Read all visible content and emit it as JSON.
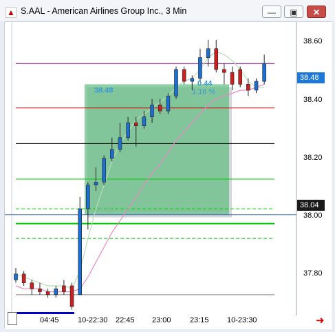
{
  "window": {
    "title": "S.AAL - American Airlines Group Inc., 3 Min"
  },
  "window_buttons": {
    "minimize": "—",
    "restore": "▣",
    "close": "✕"
  },
  "icons": {
    "app_icon": "chart-app-icon",
    "scroll_right": "red-arrow-icon"
  },
  "price_axis": {
    "ticks": [
      "38.60",
      "38.40",
      "38.20",
      "38.00",
      "37.80"
    ]
  },
  "time_axis": {
    "ticks": [
      "04:45",
      "10-22:30",
      "22:45",
      "23:00",
      "23:15",
      "10-23:30"
    ]
  },
  "price_tags": {
    "last": "38.48",
    "reference": "38.04"
  },
  "overlay": {
    "box_price": "38.48",
    "box_low": "38.04",
    "change": "0.44",
    "pct": "1.16 %"
  },
  "chart_data": {
    "type": "candlestick",
    "symbol": "S.AAL",
    "interval": "3 Min",
    "ylim": [
      37.7,
      38.69
    ],
    "bar_count": 32,
    "candles": [
      {
        "o": 37.82,
        "h": 37.86,
        "l": 37.81,
        "c": 37.84
      },
      {
        "o": 37.84,
        "h": 37.85,
        "l": 37.8,
        "c": 37.81
      },
      {
        "o": 37.81,
        "h": 37.82,
        "l": 37.77,
        "c": 37.79
      },
      {
        "o": 37.79,
        "h": 37.81,
        "l": 37.77,
        "c": 37.78
      },
      {
        "o": 37.78,
        "h": 37.79,
        "l": 37.76,
        "c": 37.77
      },
      {
        "o": 37.77,
        "h": 37.8,
        "l": 37.76,
        "c": 37.79
      },
      {
        "o": 37.8,
        "h": 37.82,
        "l": 37.77,
        "c": 37.78
      },
      {
        "o": 37.8,
        "h": 37.81,
        "l": 37.72,
        "c": 37.73
      },
      {
        "o": 37.77,
        "h": 38.1,
        "l": 37.77,
        "c": 38.06
      },
      {
        "o": 38.06,
        "h": 38.15,
        "l": 37.99,
        "c": 38.14
      },
      {
        "o": 38.14,
        "h": 38.2,
        "l": 38.12,
        "c": 38.15
      },
      {
        "o": 38.15,
        "h": 38.24,
        "l": 38.14,
        "c": 38.23
      },
      {
        "o": 38.23,
        "h": 38.3,
        "l": 38.22,
        "c": 38.26
      },
      {
        "o": 38.26,
        "h": 38.35,
        "l": 38.25,
        "c": 38.3
      },
      {
        "o": 38.3,
        "h": 38.37,
        "l": 38.29,
        "c": 38.35
      },
      {
        "o": 38.35,
        "h": 38.37,
        "l": 38.27,
        "c": 38.34
      },
      {
        "o": 38.34,
        "h": 38.39,
        "l": 38.33,
        "c": 38.37
      },
      {
        "o": 38.37,
        "h": 38.43,
        "l": 38.35,
        "c": 38.41
      },
      {
        "o": 38.41,
        "h": 38.43,
        "l": 38.38,
        "c": 38.39
      },
      {
        "o": 38.39,
        "h": 38.45,
        "l": 38.38,
        "c": 38.44
      },
      {
        "o": 38.44,
        "h": 38.54,
        "l": 38.43,
        "c": 38.53
      },
      {
        "o": 38.53,
        "h": 38.54,
        "l": 38.48,
        "c": 38.49
      },
      {
        "o": 38.49,
        "h": 38.51,
        "l": 38.46,
        "c": 38.5
      },
      {
        "o": 38.5,
        "h": 38.6,
        "l": 38.49,
        "c": 38.57
      },
      {
        "o": 38.57,
        "h": 38.63,
        "l": 38.54,
        "c": 38.6
      },
      {
        "o": 38.6,
        "h": 38.63,
        "l": 38.52,
        "c": 38.53
      },
      {
        "o": 38.53,
        "h": 38.55,
        "l": 38.48,
        "c": 38.52
      },
      {
        "o": 38.52,
        "h": 38.54,
        "l": 38.46,
        "c": 38.48
      },
      {
        "o": 38.53,
        "h": 38.54,
        "l": 38.47,
        "c": 38.48
      },
      {
        "o": 38.48,
        "h": 38.5,
        "l": 38.44,
        "c": 38.46
      },
      {
        "o": 38.46,
        "h": 38.5,
        "l": 38.45,
        "c": 38.49
      },
      {
        "o": 38.49,
        "h": 38.58,
        "l": 38.48,
        "c": 38.55
      }
    ],
    "horizontal_lines": [
      {
        "price": 38.55,
        "color": "#800080",
        "style": "solid"
      },
      {
        "price": 38.4,
        "color": "#cc0000",
        "style": "solid"
      },
      {
        "price": 38.28,
        "color": "#000000",
        "style": "solid"
      },
      {
        "price": 38.16,
        "color": "#00cc00",
        "style": "solid"
      },
      {
        "price": 38.06,
        "color": "#00cc00",
        "style": "dashed"
      },
      {
        "price": 38.04,
        "color": "#3a6fc4",
        "style": "solid"
      },
      {
        "price": 38.01,
        "color": "#00cc00",
        "style": "solid-thick"
      },
      {
        "price": 37.96,
        "color": "#00cc00",
        "style": "dashed"
      },
      {
        "price": 37.77,
        "color": "#808080",
        "style": "solid"
      }
    ],
    "moving_averages": [
      {
        "color": "#b8deb8",
        "values": [
          37.84,
          37.83,
          37.82,
          37.81,
          37.8,
          37.8,
          37.8,
          37.79,
          37.85,
          37.96,
          38.06,
          38.14,
          38.22,
          38.28,
          38.32,
          38.36,
          38.38,
          38.4,
          38.42,
          38.44,
          38.47,
          38.49,
          38.5,
          38.53,
          38.57,
          38.59,
          38.58,
          38.56,
          38.53,
          38.49,
          38.47,
          38.47
        ]
      },
      {
        "color": "#e889c4",
        "values": [
          37.8,
          37.79,
          37.79,
          37.79,
          37.78,
          37.78,
          37.78,
          37.78,
          37.79,
          37.83,
          37.88,
          37.93,
          37.98,
          38.02,
          38.06,
          38.1,
          38.14,
          38.18,
          38.21,
          38.25,
          38.29,
          38.32,
          38.35,
          38.38,
          38.41,
          38.43,
          38.44,
          38.45,
          38.46,
          38.46,
          38.47,
          38.48
        ]
      }
    ],
    "colors": {
      "up": "#1e6fd0",
      "down": "#cc2020",
      "box_fill": "#5fbe7d",
      "box_text": "#3a9ad9",
      "last_tag": "#1e78d7",
      "ref_tag": "#1a1a1a"
    }
  }
}
